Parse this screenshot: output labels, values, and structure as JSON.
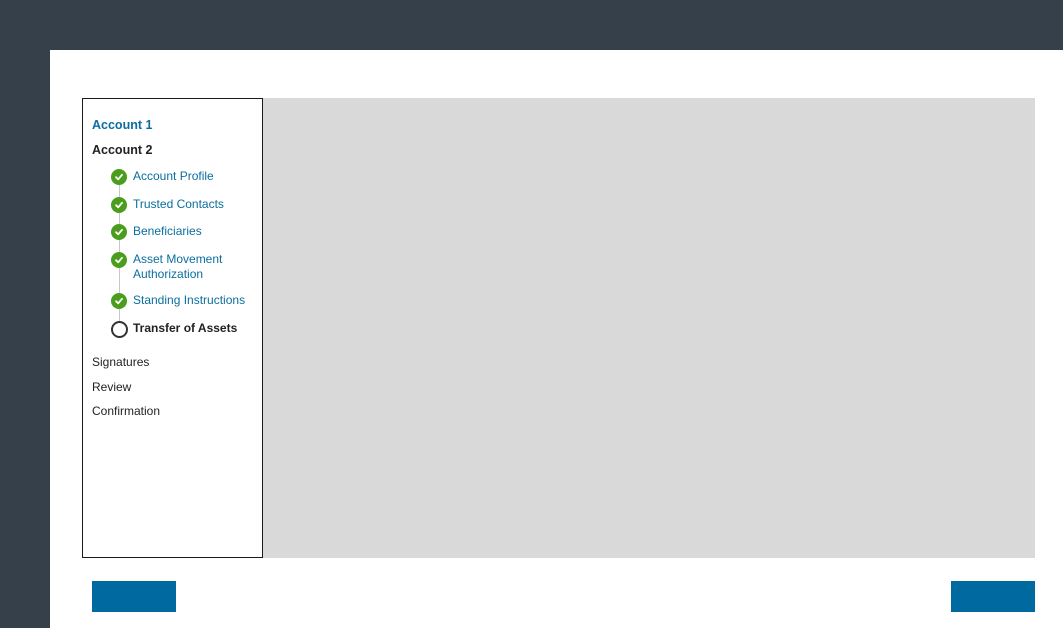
{
  "sidebar": {
    "accounts": [
      {
        "label": "Account 1"
      },
      {
        "label": "Account 2"
      }
    ],
    "steps": [
      {
        "label": "Account Profile",
        "status": "complete"
      },
      {
        "label": "Trusted Contacts",
        "status": "complete"
      },
      {
        "label": "Beneficiaries",
        "status": "complete"
      },
      {
        "label": "Asset Movement Authorization",
        "status": "complete"
      },
      {
        "label": "Standing Instructions",
        "status": "complete"
      },
      {
        "label": "Transfer of Assets",
        "status": "current"
      }
    ],
    "sections": [
      {
        "label": "Signatures"
      },
      {
        "label": "Review"
      },
      {
        "label": "Confirmation"
      }
    ]
  },
  "footer": {
    "back_label": "",
    "next_label": ""
  },
  "colors": {
    "frame": "#36404a",
    "link": "#0a6e9e",
    "complete": "#4b9e1d",
    "primary_button": "#006aa0",
    "content_placeholder": "#d9d9d9"
  }
}
